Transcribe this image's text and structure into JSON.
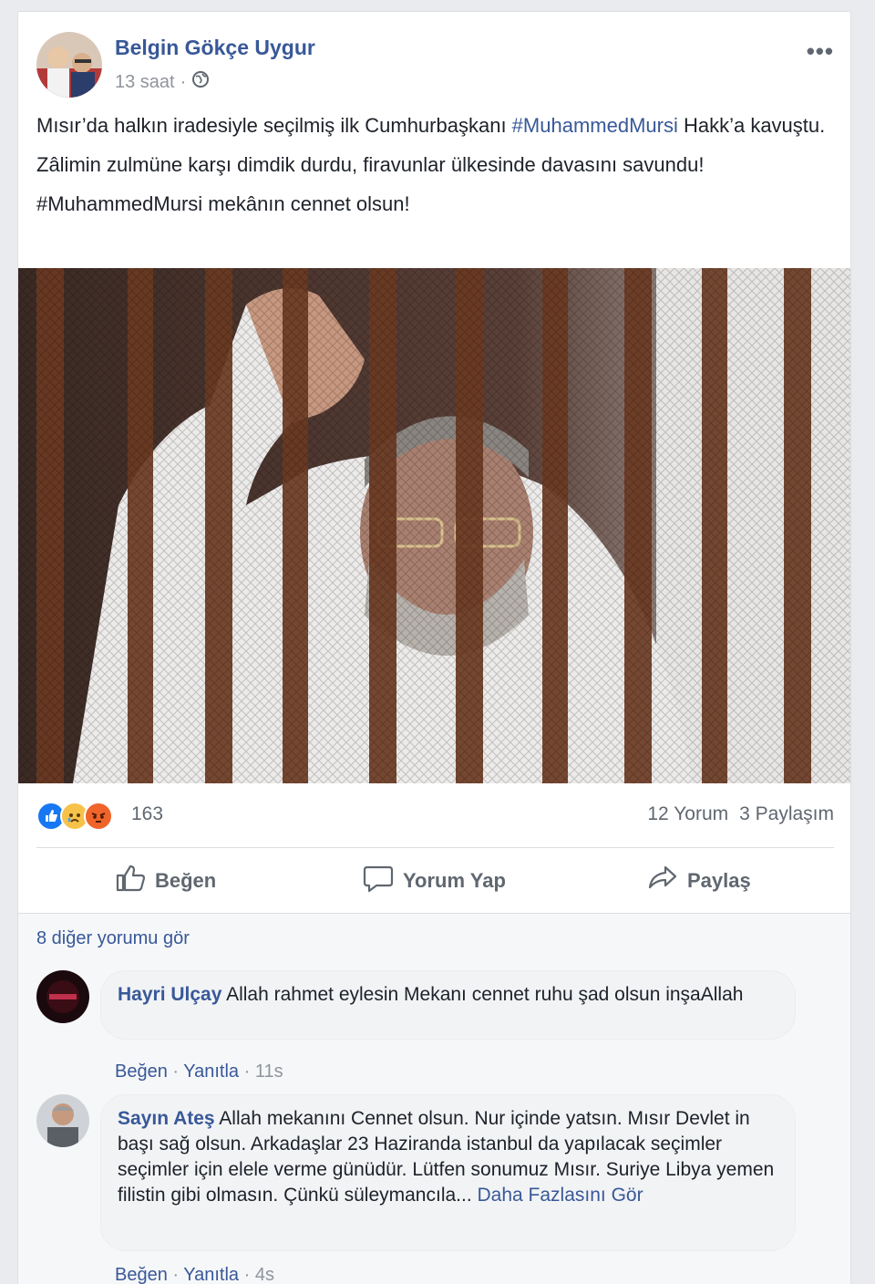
{
  "post": {
    "author": "Belgin Gökçe Uygur",
    "time": "13 saat",
    "time_separator": "·",
    "privacy_icon": "globe-icon",
    "more_icon": "•••",
    "line1_before": "Mısır’da halkın iradesiyle seçilmiş ilk Cumhurbaşkanı ",
    "line1_tag": "#MuhammedMursi",
    "line1_after": " Hakk’a kavuştu.",
    "line2": "Zâlimin zulmüne karşı dimdik durdu, firavunlar ülkesinde davasını savundu!",
    "line3": "#MuhammedMursi mekânın cennet olsun!"
  },
  "stats": {
    "reaction_count": "163",
    "comments": "12 Yorum",
    "shares": "3 Paylaşım"
  },
  "actions": {
    "like": "Beğen",
    "comment": "Yorum Yap",
    "share": "Paylaş"
  },
  "comments_section": {
    "see_more": "8 diğer yorumu gör",
    "items": [
      {
        "name": "Hayri Ulçay",
        "text": "Allah rahmet eylesin Mekanı cennet ruhu şad olsun inşaAllah",
        "like": "Beğen",
        "reply": "Yanıtla",
        "time": "11s"
      },
      {
        "name": "Sayın Ateş",
        "text": "Allah mekanını Cennet olsun. Nur içinde yatsın. Mısır Devlet in başı sağ olsun. Arkadaşlar 23 Haziranda istanbul da yapılacak seçimler seçimler için elele verme günüdür. Lütfen sonumuz Mısır. Suriye Libya yemen filistin gibi olmasın. Çünkü süleymancıla...",
        "read_more": "Daha Fazlasını Gör",
        "like": "Beğen",
        "reply": "Yanıtla",
        "time": "4s"
      }
    ]
  },
  "colors": {
    "link": "#385898",
    "muted": "#90949c",
    "like_blue": "#1877f2",
    "angry_orange": "#f0642a",
    "sad_yellow": "#f7c24a"
  }
}
